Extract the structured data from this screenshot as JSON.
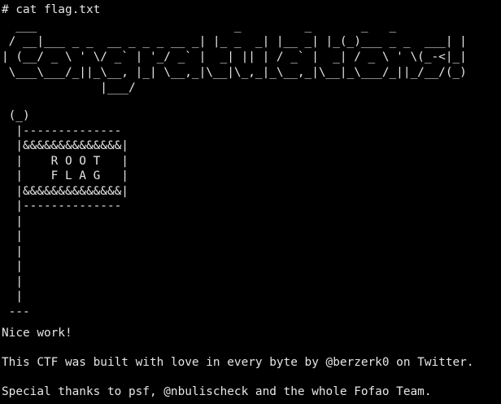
{
  "terminal": {
    "prompt": "# cat flag.txt",
    "banner_art": "  ___                            _         _       _   _                 _ \n / __|___ _ _  __ _ _ _ __ _| |_ _  _| |__ _| |_(_)___ _ _  ___| |\n| (__/ _ \\ ' \\/ _` | '_/ _` |  _| || | / _` |  _| / _ \\ ' \\(_-<|_|\n \\___\\___/_||_\\__, |_| \\__,_|\\__|\\_,_|_\\__,_|\\__|_\\___/_||_/__/(_)\n              |___/",
    "flag_art": " (_)\n  |--------------\n  |&&&&&&&&&&&&&&|\n  |    R O O T   |\n  |    F L A G   |\n  |&&&&&&&&&&&&&&|\n  |--------------\n  |\n  |\n  |\n  |\n  |\n  |\n ---",
    "message_1": "Nice work!",
    "message_2": "This CTF was built with love in every byte by @berzerk0 on Twitter.",
    "message_3": "Special thanks to psf, @nbulischeck and the whole Fofao Team."
  }
}
